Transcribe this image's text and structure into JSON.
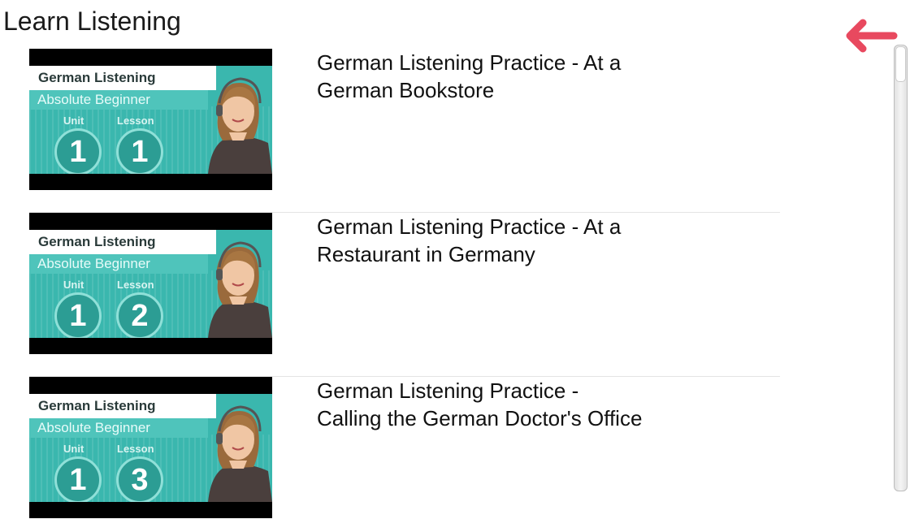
{
  "header": {
    "title": "Learn Listening",
    "back_icon": "back-arrow-icon",
    "accent_color": "#e8495f"
  },
  "items": [
    {
      "title": "German Listening Practice - At a\nGerman Bookstore",
      "thumb": {
        "heading": "German Listening",
        "subheading": "Absolute Beginner",
        "unit_label": "Unit",
        "lesson_label": "Lesson",
        "unit": "1",
        "lesson": "1"
      }
    },
    {
      "title": "German Listening Practice - At a\nRestaurant in Germany",
      "thumb": {
        "heading": "German Listening",
        "subheading": "Absolute Beginner",
        "unit_label": "Unit",
        "lesson_label": "Lesson",
        "unit": "1",
        "lesson": "2"
      }
    },
    {
      "title": "German Listening Practice -\nCalling the German Doctor's Office",
      "thumb": {
        "heading": "German Listening",
        "subheading": "Absolute Beginner",
        "unit_label": "Unit",
        "lesson_label": "Lesson",
        "unit": "1",
        "lesson": "3"
      }
    }
  ],
  "scrollbar": {
    "position_fraction": 0.0
  }
}
